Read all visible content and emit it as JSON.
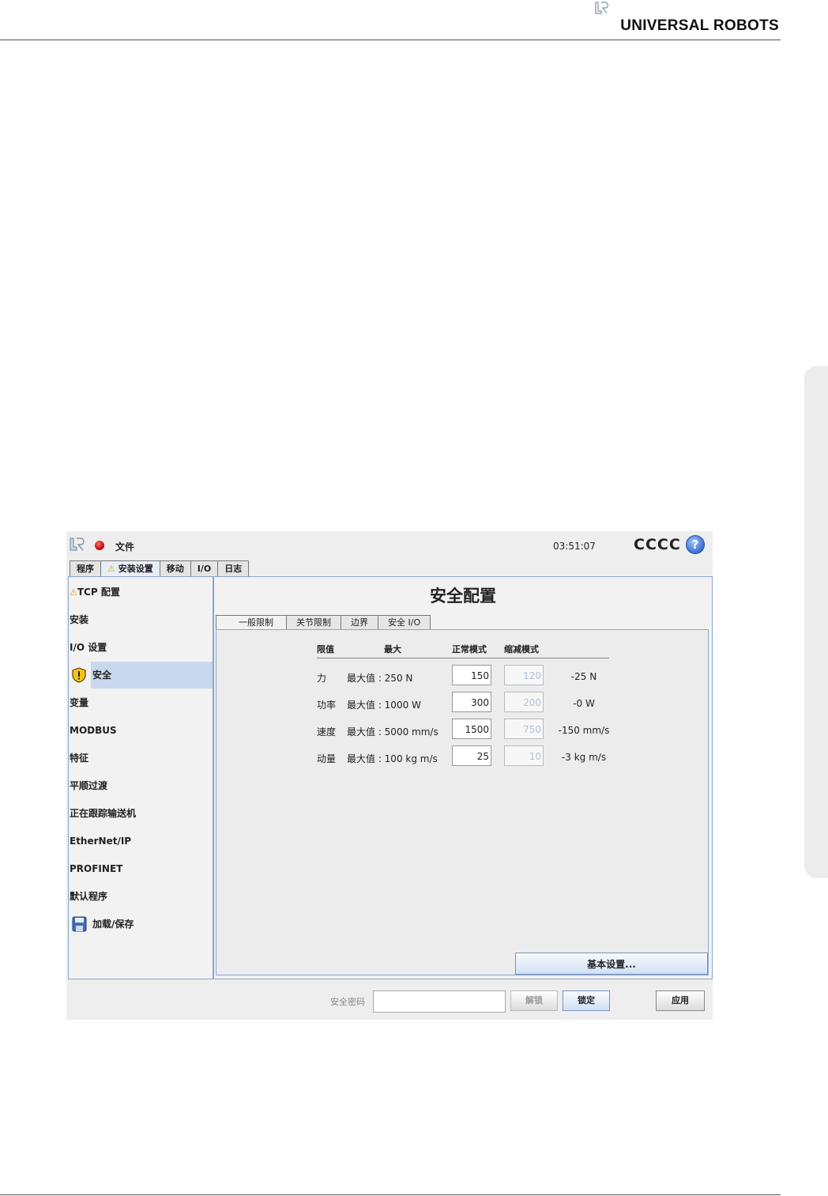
{
  "page": {
    "brand": "UNIVERSAL ROBOTS"
  },
  "ui": {
    "titlebar": {
      "file_menu": "文件",
      "clock": "03:51:07",
      "robot_name": "CCCC",
      "help_symbol": "?"
    },
    "main_tabs": [
      {
        "label": "程序",
        "warning": false
      },
      {
        "label": "安装设置",
        "warning": true
      },
      {
        "label": "移动",
        "warning": false
      },
      {
        "label": "I/O",
        "warning": false
      },
      {
        "label": "日志",
        "warning": false
      }
    ],
    "warning_symbol": "⚠",
    "sidebar": [
      {
        "label": "TCP 配置",
        "icon": "warning-icon"
      },
      {
        "label": "安装"
      },
      {
        "label": "I/O 设置"
      },
      {
        "label": "安全",
        "icon": "shield-icon",
        "selected": true
      },
      {
        "label": "变量"
      },
      {
        "label": "MODBUS"
      },
      {
        "label": "特征"
      },
      {
        "label": "平顺过渡"
      },
      {
        "label": "正在跟踪输送机"
      },
      {
        "label": "EtherNet/IP"
      },
      {
        "label": "PROFINET"
      },
      {
        "label": "默认程序"
      },
      {
        "label": "加载/保存",
        "icon": "floppy-disk-icon"
      }
    ],
    "page_title": "安全配置",
    "sub_tabs": [
      "一般限制",
      "关节限制",
      "边界",
      "安全 I/O"
    ],
    "table": {
      "headers": {
        "limit": "限值",
        "max": "最大",
        "normal": "正常模式",
        "reduced": "缩减模式"
      },
      "rows": [
        {
          "name": "力",
          "max": "最大值 : 250 N",
          "normal": "150",
          "reduced": "120",
          "delta": "-25 N"
        },
        {
          "name": "功率",
          "max": "最大值 : 1000 W",
          "normal": "300",
          "reduced": "200",
          "delta": "-0 W"
        },
        {
          "name": "速度",
          "max": "最大值 : 5000 mm/s",
          "normal": "1500",
          "reduced": "750",
          "delta": "-150 mm/s"
        },
        {
          "name": "动量",
          "max": "最大值 : 100 kg m/s",
          "normal": "25",
          "reduced": "10",
          "delta": "-3 kg m/s"
        }
      ]
    },
    "basic_settings_button": "基本设置...",
    "footer": {
      "password_label": "安全密码",
      "password_value": "",
      "unlock_button": "解锁",
      "lock_button": "锁定",
      "apply_button": "应用"
    },
    "colors": {
      "accent": "#c8d8ee",
      "border": "#8aa5cf",
      "warning": "#d7a400",
      "record": "#c01010"
    }
  }
}
